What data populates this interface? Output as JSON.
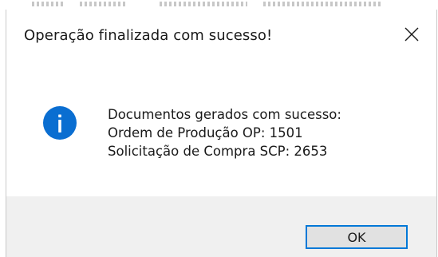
{
  "dialog": {
    "title": "Operação finalizada com sucesso!",
    "close_icon": "close-icon",
    "info_icon": "info-icon",
    "message_lines": [
      "Documentos gerados com sucesso:",
      "Ordem de Produção OP: 1501",
      "Solicitação de Compra SCP: 2653"
    ],
    "ok_label": "OK"
  },
  "colors": {
    "accent": "#0078d7",
    "footer_bg": "#f0f0f0",
    "button_bg": "#e1e1e1"
  }
}
